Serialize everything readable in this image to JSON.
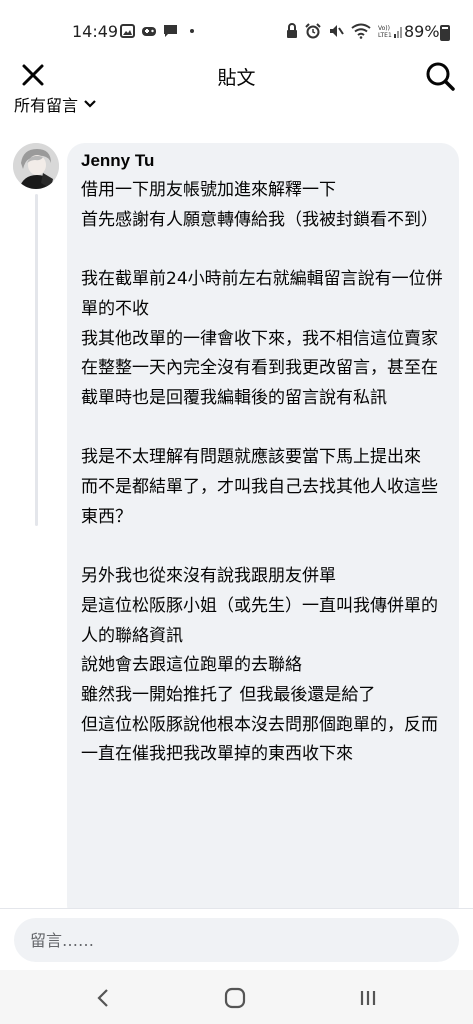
{
  "status_bar": {
    "time": "14:49",
    "battery": "89%",
    "left_icons": [
      "image-icon",
      "game-icon",
      "message-icon"
    ],
    "right_icons": [
      "lock-icon",
      "alarm-icon",
      "mute-icon",
      "wifi-icon",
      "signal-icon"
    ]
  },
  "header": {
    "title": "貼文",
    "close_icon": "close-icon",
    "search_icon": "search-icon"
  },
  "filter": {
    "label": "所有留言",
    "icon": "chevron-down-icon"
  },
  "comment": {
    "author": "Jenny Tu",
    "body": "借用一下朋友帳號加進來解釋一下\n首先感謝有人願意轉傳給我（我被封鎖看不到）\n\n我在截單前24小時前左右就編輯留言說有一位併單的不收\n我其他改單的一律會收下來，我不相信這位賣家在整整一天內完全沒有看到我更改留言，甚至在截單時也是回覆我編輯後的留言說有私訊\n\n我是不太理解有問題就應該要當下馬上提出來\n而不是都結單了，才叫我自己去找其他人收這些東西？\n\n另外我也從來沒有說我跟朋友併單\n是這位松阪豚小姐（或先生）一直叫我傳併單的人的聯絡資訊\n說她會去跟這位跑單的去聯絡\n雖然我一開始推托了 但我最後還是給了\n但這位松阪豚說他根本沒去問那個跑單的，反而一直在催我把我改單掉的東西收下來"
  },
  "compose": {
    "placeholder": "留言……"
  },
  "nav": {
    "back_icon": "back-icon",
    "home_icon": "home-icon",
    "recents_icon": "recents-icon"
  },
  "colors": {
    "bubble": "#f0f2f5",
    "text": "#050505",
    "muted": "#65676b",
    "nav_bg": "#f6f6f6"
  }
}
